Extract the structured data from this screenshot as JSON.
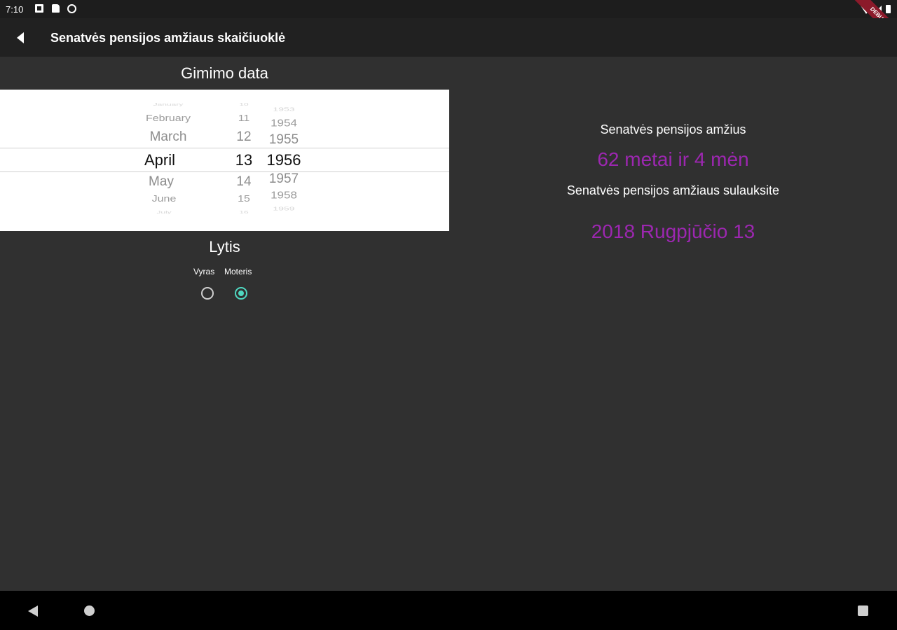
{
  "status": {
    "time": "7:10",
    "ribbon": "DEBUG"
  },
  "app_bar": {
    "title": "Senatvės pensijos amžiaus skaičiuoklė"
  },
  "birth": {
    "title": "Gimimo data",
    "months": [
      "January",
      "February",
      "March",
      "April",
      "May",
      "June",
      "July"
    ],
    "days": [
      "10",
      "11",
      "12",
      "13",
      "14",
      "15",
      "16"
    ],
    "years": [
      "1953",
      "1954",
      "1955",
      "1956",
      "1957",
      "1958",
      "1959"
    ],
    "selected_month": "April",
    "selected_day": "13",
    "selected_year": "1956"
  },
  "gender": {
    "title": "Lytis",
    "options": [
      "Vyras",
      "Moteris"
    ],
    "selected": "Moteris"
  },
  "result": {
    "age_label": "Senatvės pensijos amžius",
    "age_value": "62 metai ir 4 mėn",
    "date_label": "Senatvės pensijos amžiaus sulauksite",
    "date_value": "2018 Rugpjūčio 13"
  },
  "colors": {
    "accent": "#9c27b0",
    "radio_accent": "#4fd8c1",
    "background": "#303030",
    "app_bar": "#212121"
  },
  "icons": {
    "back": "arrow-back-icon",
    "nav_back": "nav-back-icon",
    "nav_home": "nav-home-icon",
    "nav_recents": "nav-recents-icon"
  }
}
